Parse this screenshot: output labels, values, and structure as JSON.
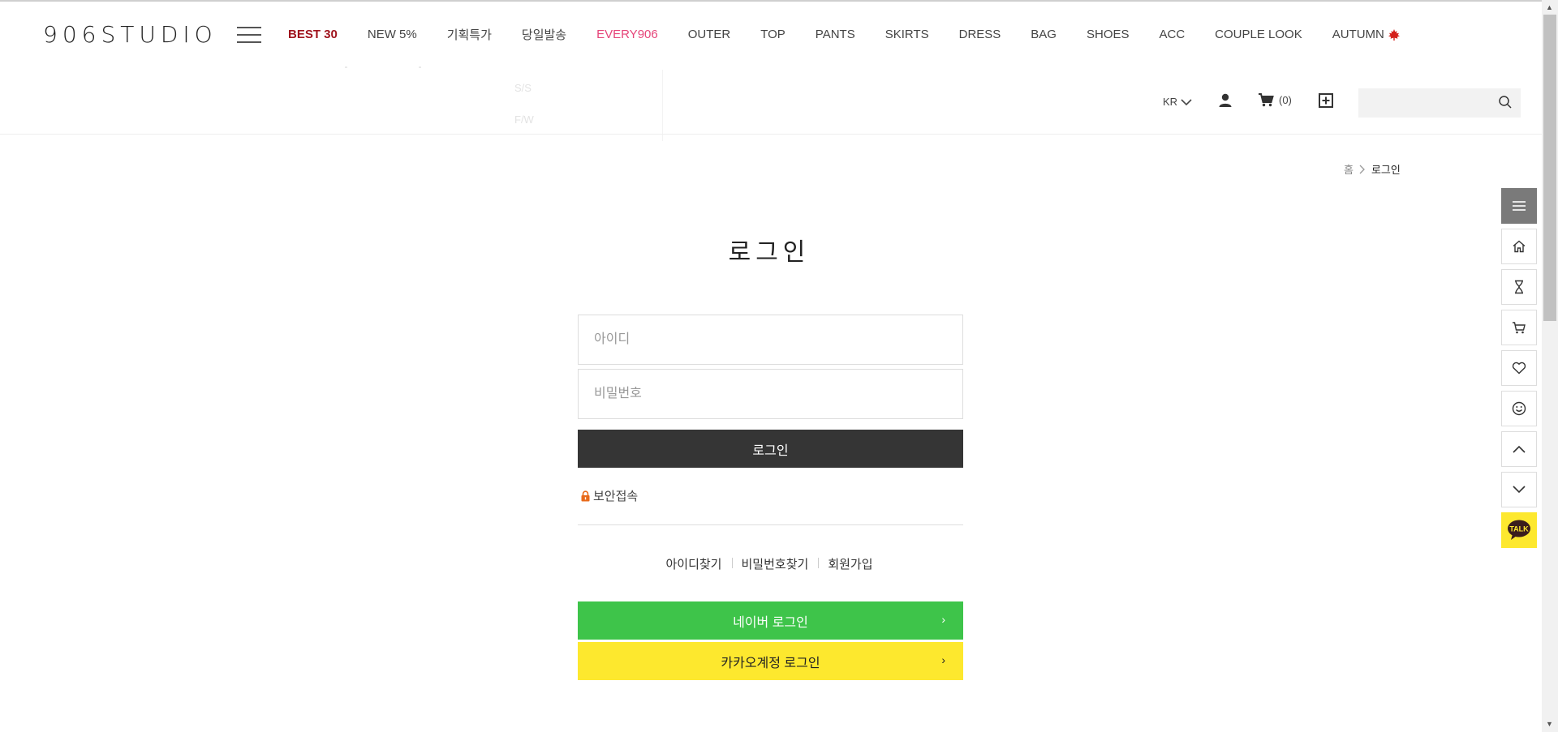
{
  "header": {
    "logo": "906STUDIO",
    "nav": [
      {
        "label": "BEST 30",
        "style": "best"
      },
      {
        "label": "NEW 5%",
        "style": "normal"
      },
      {
        "label": "기획특가",
        "style": "normal"
      },
      {
        "label": "당일발송",
        "style": "normal"
      },
      {
        "label": "EVERY906",
        "style": "every"
      },
      {
        "label": "OUTER",
        "style": "normal"
      },
      {
        "label": "TOP",
        "style": "normal"
      },
      {
        "label": "PANTS",
        "style": "normal"
      },
      {
        "label": "SKIRTS",
        "style": "normal"
      },
      {
        "label": "DRESS",
        "style": "normal"
      },
      {
        "label": "BAG",
        "style": "normal"
      },
      {
        "label": "SHOES",
        "style": "normal"
      },
      {
        "label": "ACC",
        "style": "normal"
      },
      {
        "label": "COUPLE LOOK",
        "style": "normal"
      },
      {
        "label": "AUTUMN",
        "style": "normal"
      }
    ],
    "submenu": [
      "S/S",
      "F/W"
    ],
    "language": "KR",
    "cart_count": "(0)",
    "search_placeholder": ""
  },
  "breadcrumb": {
    "home": "홈",
    "current": "로그인"
  },
  "login": {
    "title": "로그인",
    "id_placeholder": "아이디",
    "pw_placeholder": "비밀번호",
    "submit": "로그인",
    "secure": "보안접속",
    "links": [
      "아이디찾기",
      "비밀번호찾기",
      "회원가입"
    ],
    "naver": "네이버 로그인",
    "kakao": "카카오계정 로그인"
  },
  "quickbar": {
    "talk": "TALK",
    "icons": [
      "menu-icon",
      "home-icon",
      "hourglass-icon",
      "cart-icon",
      "heart-icon",
      "smile-icon",
      "chevron-up-icon",
      "chevron-down-icon",
      "kakaotalk-icon"
    ]
  },
  "colors": {
    "best": "#a0141e",
    "every": "#e6457a",
    "naver": "#3ec44a",
    "kakao": "#fde82e",
    "login_button": "#353535"
  }
}
